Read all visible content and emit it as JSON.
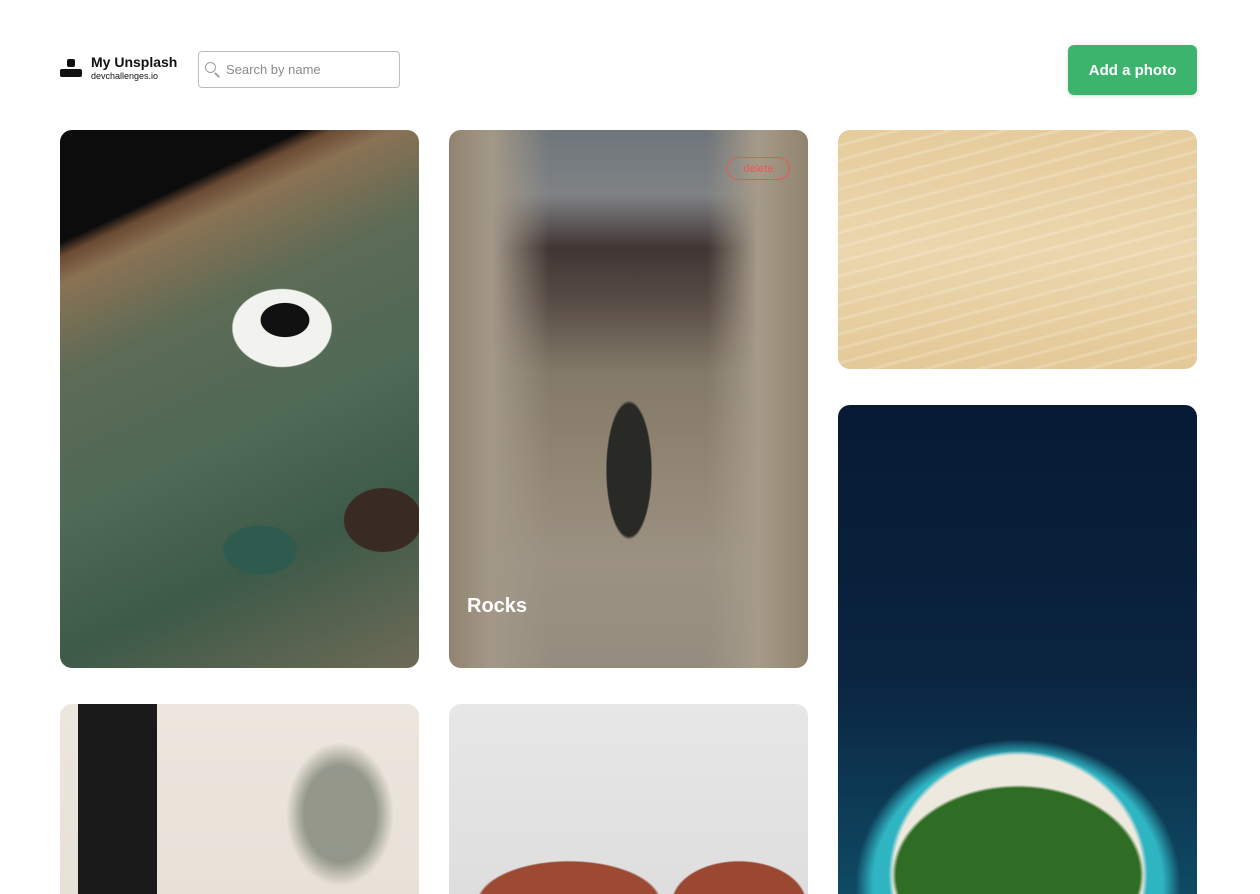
{
  "header": {
    "logo_title": "My Unsplash",
    "logo_subtitle": "devchallenges.io",
    "search_placeholder": "Search by name",
    "add_button_label": "Add a photo"
  },
  "photos": [
    {
      "id": "coffee-map",
      "label": ""
    },
    {
      "id": "rocks",
      "label": "Rocks",
      "delete_label": "delete"
    },
    {
      "id": "desert",
      "label": ""
    },
    {
      "id": "coast",
      "label": ""
    },
    {
      "id": "room-plants",
      "label": ""
    },
    {
      "id": "bags",
      "label": ""
    }
  ],
  "colors": {
    "accent": "#3db46d",
    "delete": "#eb5757"
  }
}
